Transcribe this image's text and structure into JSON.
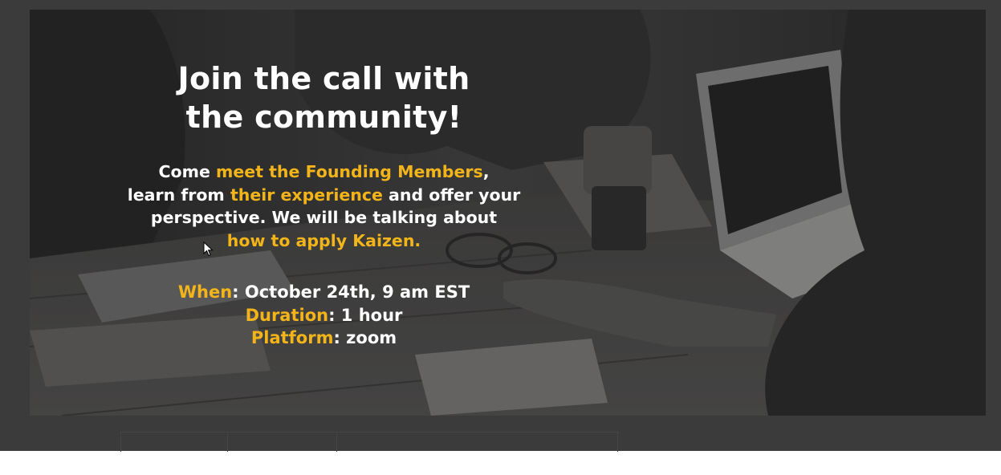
{
  "banner": {
    "headline_line1": "Join the call with",
    "headline_line2": "the community!",
    "blurb": {
      "l1_a": "Come ",
      "l1_hl": "meet the Founding Members",
      "l1_b": ",",
      "l2_a": "learn from ",
      "l2_hl": "their experience",
      "l2_b": " and offer your",
      "l3": "perspective. We will be talking about",
      "l4_hl": "how to apply Kaizen."
    },
    "details": {
      "when_label": "When",
      "when_value": ": October 24th, 9 am EST",
      "duration_label": "Duration",
      "duration_value": ": 1 hour",
      "platform_label": "Platform",
      "platform_value": ": zoom"
    }
  },
  "colors": {
    "accent": "#f3b41a",
    "text": "#ffffff",
    "backdrop": "#3b3b3b"
  },
  "icons": {
    "cursor": "mouse-pointer-icon"
  }
}
